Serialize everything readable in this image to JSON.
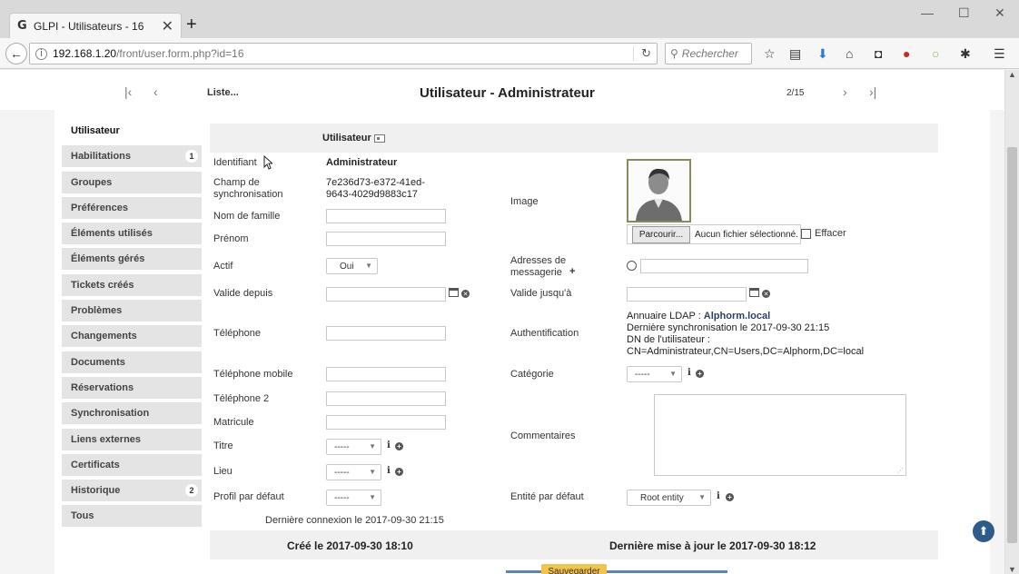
{
  "browser": {
    "tab_favicon": "G",
    "tab_title": "GLPI - Utilisateurs - 16",
    "tab_close": "✕",
    "new_tab": "+",
    "url_host": "192.168.1.20",
    "url_path": "/front/user.form.php?id=16",
    "search_placeholder": "Rechercher"
  },
  "header": {
    "liste_link": "Liste...",
    "title": "Utilisateur - Administrateur",
    "counter": "2/15"
  },
  "sidebar": {
    "items": [
      {
        "label": "Utilisateur",
        "badge": ""
      },
      {
        "label": "Habilitations",
        "badge": "1"
      },
      {
        "label": "Groupes",
        "badge": ""
      },
      {
        "label": "Préférences",
        "badge": ""
      },
      {
        "label": "Éléments utilisés",
        "badge": ""
      },
      {
        "label": "Éléments gérés",
        "badge": ""
      },
      {
        "label": "Tickets créés",
        "badge": ""
      },
      {
        "label": "Problèmes",
        "badge": ""
      },
      {
        "label": "Changements",
        "badge": ""
      },
      {
        "label": "Documents",
        "badge": ""
      },
      {
        "label": "Réservations",
        "badge": ""
      },
      {
        "label": "Synchronisation",
        "badge": ""
      },
      {
        "label": "Liens externes",
        "badge": ""
      },
      {
        "label": "Certificats",
        "badge": ""
      },
      {
        "label": "Historique",
        "badge": "2"
      },
      {
        "label": "Tous",
        "badge": ""
      }
    ]
  },
  "form": {
    "section_title": "Utilisateur",
    "labels": {
      "identifiant": "Identifiant",
      "champ_sync_1": "Champ de",
      "champ_sync_2": "synchronisation",
      "nom": "Nom de famille",
      "prenom": "Prénom",
      "actif": "Actif",
      "valide_depuis": "Valide depuis",
      "telephone": "Téléphone",
      "tel_mobile": "Téléphone mobile",
      "tel2": "Téléphone 2",
      "matricule": "Matricule",
      "titre": "Titre",
      "lieu": "Lieu",
      "profil": "Profil par défaut",
      "image": "Image",
      "adresses_1": "Adresses de",
      "adresses_2": "messagerie",
      "valide_jusqua": "Valide jusqu'à",
      "authentification": "Authentification",
      "categorie": "Catégorie",
      "commentaires": "Commentaires",
      "entite": "Entité par défaut"
    },
    "values": {
      "identifiant": "Administrateur",
      "sync_1": "7e236d73-e372-41ed-",
      "sync_2": "9643-4029d9883c17",
      "actif": "Oui",
      "titre": "-----",
      "lieu": "-----",
      "profil": "-----",
      "categorie": "-----",
      "entite": "Root entity",
      "file_button": "Parcourir...",
      "file_status": "Aucun fichier sélectionné.",
      "effacer": "Effacer",
      "auth_line1_prefix": "Annuaire LDAP : ",
      "auth_line1_link": "Alphorm.local",
      "auth_line2": "Dernière synchronisation le 2017-09-30 21:15",
      "auth_line3": "DN de l'utilisateur :",
      "auth_line4": "CN=Administrateur,CN=Users,DC=Alphorm,DC=local"
    },
    "last_login": "Dernière connexion le 2017-09-30 21:15",
    "created": "Créé le 2017-09-30 18:10",
    "updated": "Dernière mise à jour le 2017-09-30 18:12",
    "save_button": "Sauvegarder"
  },
  "icons": {
    "info": "i",
    "plus": "+",
    "caret": "▼",
    "clear": "✕",
    "up": "⬆"
  }
}
